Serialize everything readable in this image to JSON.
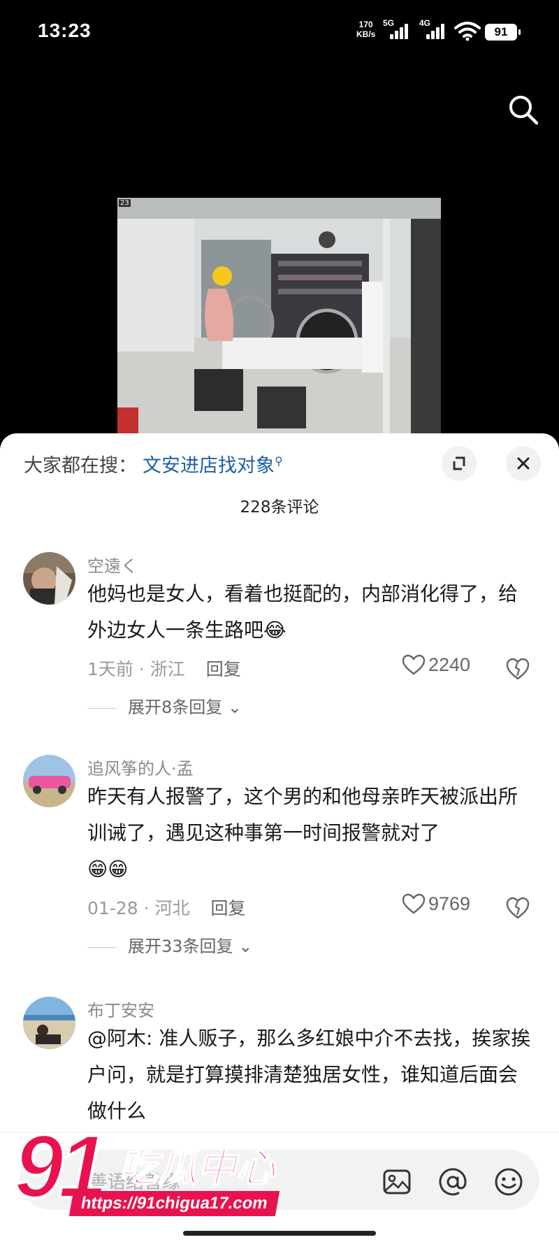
{
  "status_bar": {
    "time": "13:23",
    "net_speed_value": "170",
    "net_speed_unit": "KB/s",
    "signal_1": "5G",
    "signal_2": "4G",
    "battery": "91"
  },
  "video": {
    "frame_label": "23"
  },
  "sheet": {
    "hot_search_label": "大家都在搜：",
    "hot_search_keyword": "文安进店找对象",
    "comment_count": "228条评论"
  },
  "comments": [
    {
      "username": "空遠く",
      "text": "他妈也是女人，看着也挺配的，内部消化得了，给外边女人一条生路吧",
      "emoji": "😂",
      "time_location": "1天前 · 浙江",
      "reply": "回复",
      "likes": "2240",
      "expand": "展开8条回复"
    },
    {
      "username": "追风筝的人·孟",
      "text": "昨天有人报警了，这个男的和他母亲昨天被派出所训诫了，遇见这种事第一时间报警就对了",
      "emoji": "😁😁",
      "time_location": "01-28 · 河北",
      "reply": "回复",
      "likes": "9769",
      "expand": "展开33条回复"
    },
    {
      "username": "布丁安安",
      "text": "@阿木: 准人贩子，那么多红娘中介不去找，挨家挨户问，就是打算摸排清楚独居女性，谁知道后面会做什么"
    }
  ],
  "bottom_bar": {
    "placeholder": "善语结善缘"
  },
  "watermark": {
    "number": "91",
    "name": "吃瓜中心",
    "url": "https://91chigua17.com"
  },
  "icons": {
    "search": "search-icon",
    "expand": "expand-icon",
    "close": "close-icon",
    "like": "heart-icon",
    "dislike": "broken-heart-icon",
    "image": "image-icon",
    "mention": "at-icon",
    "emoji": "emoji-icon"
  },
  "colors": {
    "accent": "#1e5fa8",
    "watermark": "#e8124f"
  }
}
